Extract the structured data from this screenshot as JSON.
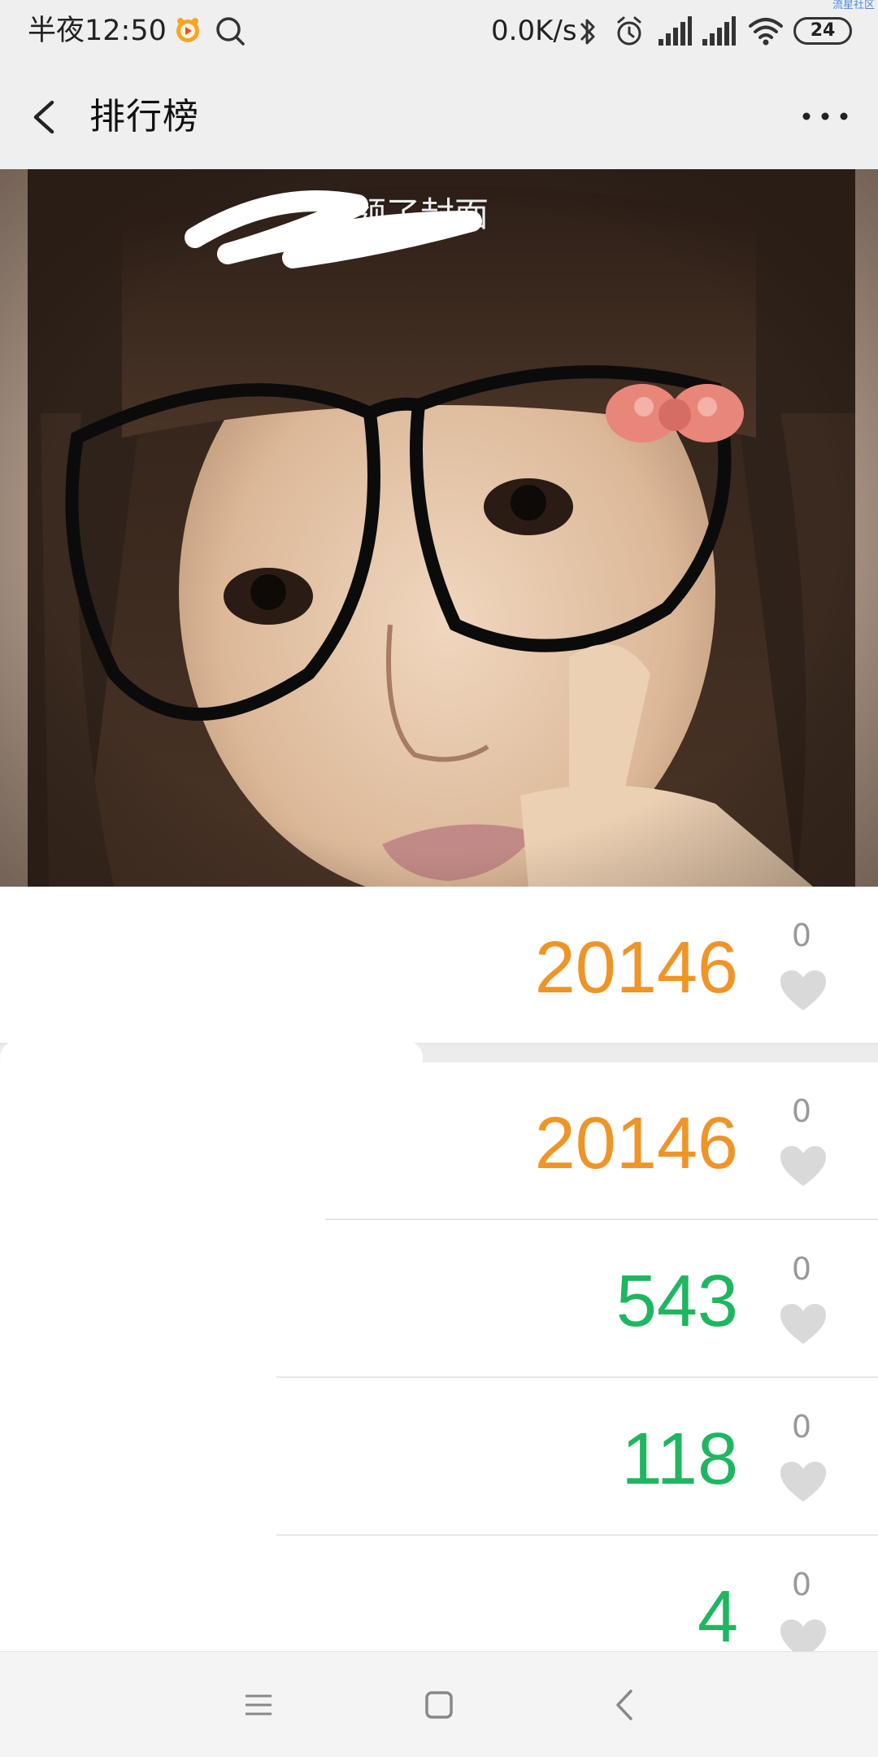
{
  "status_bar": {
    "time": "半夜12:50",
    "network_speed": "0.0K/s",
    "battery": "24",
    "watermark": "流星社区",
    "icons": [
      "app-notification-icon",
      "search-icon",
      "bluetooth-icon",
      "alarm-icon",
      "signal-icon",
      "signal-icon",
      "wifi-icon",
      "battery-icon"
    ]
  },
  "header": {
    "title": "排行榜",
    "back_icon": "back-arrow-icon",
    "more_icon": "more-icon"
  },
  "cover": {
    "caption": "占领了封面"
  },
  "ranking": {
    "rows": [
      {
        "score": "20146",
        "likes": "0",
        "color": "#ef9427"
      },
      {
        "score": "20146",
        "likes": "0",
        "color": "#ef9427"
      },
      {
        "score": "543",
        "likes": "0",
        "color": "#1fb660"
      },
      {
        "score": "118",
        "likes": "0",
        "color": "#1fb660"
      },
      {
        "score": "4",
        "likes": "0",
        "color": "#1fb660"
      }
    ]
  },
  "nav": {
    "buttons": [
      "menu-icon",
      "home-icon",
      "back-icon"
    ]
  },
  "colors": {
    "bar_bg": "#efefef",
    "orange": "#ef9427",
    "green": "#1fb660",
    "heart": "#d9d9d9"
  }
}
